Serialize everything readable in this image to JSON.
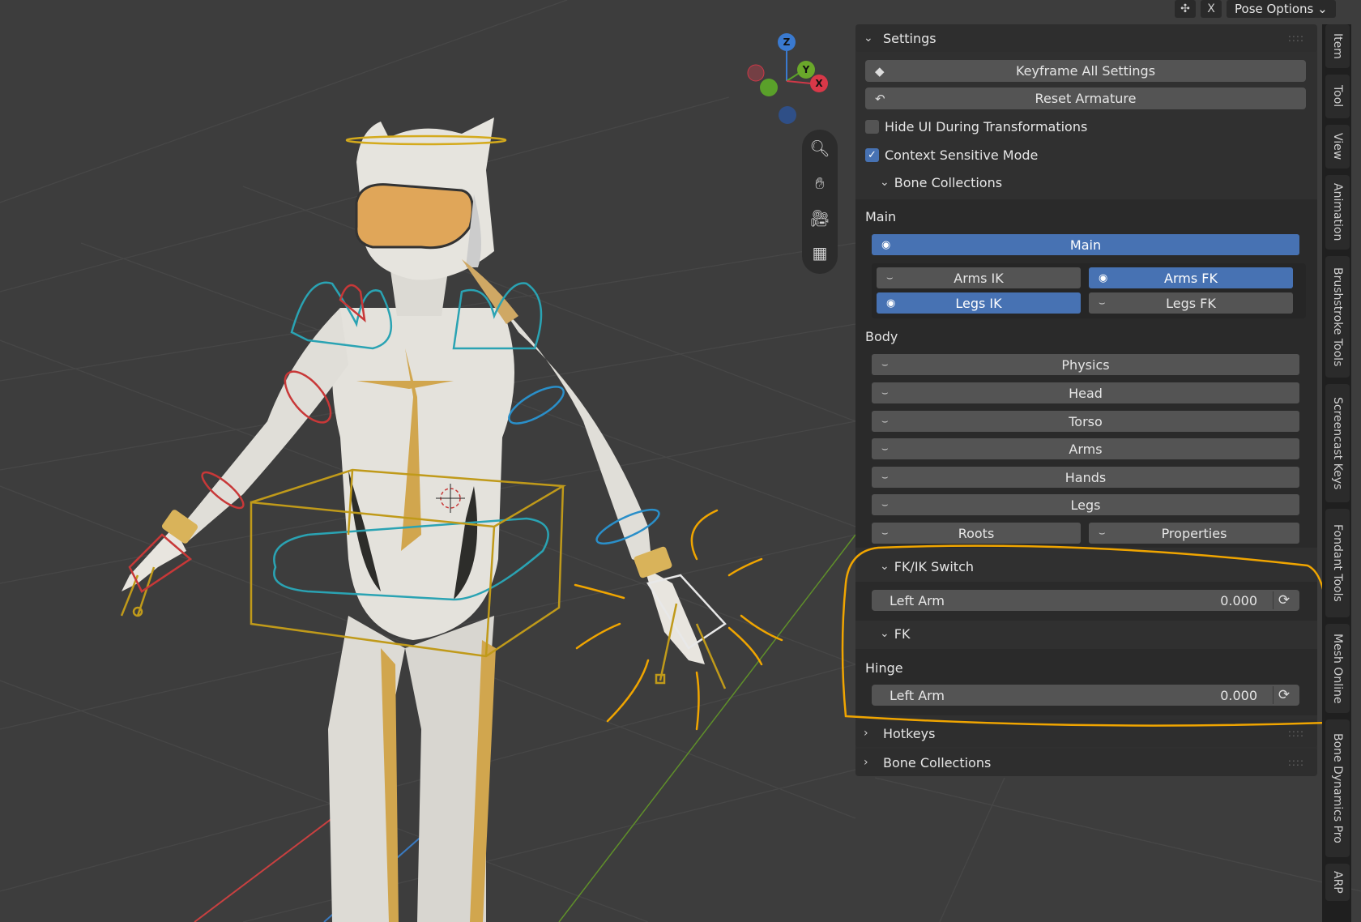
{
  "topbar": {
    "x_label": "X",
    "pose_options": "Pose Options"
  },
  "gizmo": {
    "z": "Z",
    "y": "Y",
    "x": "X"
  },
  "nav_tools": [
    "zoom-icon",
    "hand-icon",
    "camera-icon",
    "grid-icon"
  ],
  "settings": {
    "header": "Settings",
    "keyframe_all": "Keyframe All Settings",
    "reset_armature": "Reset Armature",
    "hide_ui": {
      "label": "Hide UI During Transformations",
      "checked": false
    },
    "context_sensitive": {
      "label": "Context Sensitive Mode",
      "checked": true
    },
    "bone_collections_sub": "Bone Collections",
    "main_label": "Main",
    "main_btn": "Main",
    "arms_ik": "Arms IK",
    "arms_fk": "Arms FK",
    "legs_ik": "Legs IK",
    "legs_fk": "Legs FK",
    "body_label": "Body",
    "physics": "Physics",
    "head": "Head",
    "torso": "Torso",
    "arms": "Arms",
    "hands": "Hands",
    "legs": "Legs",
    "roots": "Roots",
    "properties": "Properties",
    "fkik_switch": "FK/IK Switch",
    "fkik_left_arm": {
      "label": "Left Arm",
      "value": "0.000"
    },
    "fk": "FK",
    "hinge_label": "Hinge",
    "hinge_left_arm": {
      "label": "Left Arm",
      "value": "0.000"
    }
  },
  "hotkeys": "Hotkeys",
  "bone_collections": "Bone Collections",
  "tabs": [
    "Item",
    "Tool",
    "View",
    "Animation",
    "Brushstroke Tools",
    "Screencast Keys",
    "Fondant Tools",
    "Mesh Online",
    "Bone Dynamics Pro",
    "ARP"
  ],
  "colors": {
    "accent": "#4772b3",
    "annotation": "#f0a500",
    "panel": "#303030",
    "button": "#545454"
  }
}
